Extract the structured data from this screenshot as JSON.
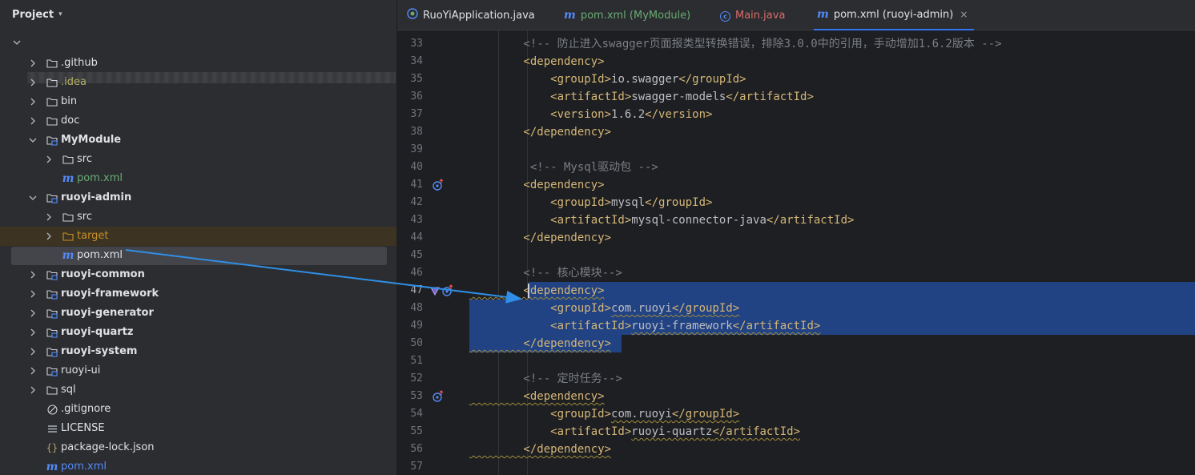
{
  "project_panel": {
    "title": "Project",
    "tree": [
      {
        "label": ".github",
        "type": "folder",
        "style": "normal"
      },
      {
        "label": ".idea",
        "type": "folder",
        "style": "yellow"
      },
      {
        "label": "bin",
        "type": "folder",
        "style": "normal"
      },
      {
        "label": "doc",
        "type": "folder",
        "style": "normal"
      },
      {
        "label": "MyModule",
        "type": "module",
        "style": "bold",
        "expanded": true
      },
      {
        "label": "src",
        "type": "folder",
        "style": "normal"
      },
      {
        "label": "pom.xml",
        "type": "maven",
        "style": "green"
      },
      {
        "label": "ruoyi-admin",
        "type": "module",
        "style": "bold",
        "expanded": true
      },
      {
        "label": "src",
        "type": "folder",
        "style": "normal"
      },
      {
        "label": "target",
        "type": "folder-target",
        "style": "orange"
      },
      {
        "label": "pom.xml",
        "type": "maven",
        "style": "normal",
        "selected": true
      },
      {
        "label": "ruoyi-common",
        "type": "module",
        "style": "bold"
      },
      {
        "label": "ruoyi-framework",
        "type": "module",
        "style": "bold"
      },
      {
        "label": "ruoyi-generator",
        "type": "module",
        "style": "bold"
      },
      {
        "label": "ruoyi-quartz",
        "type": "module",
        "style": "bold"
      },
      {
        "label": "ruoyi-system",
        "type": "module",
        "style": "bold"
      },
      {
        "label": "ruoyi-ui",
        "type": "module",
        "style": "normal"
      },
      {
        "label": "sql",
        "type": "folder",
        "style": "normal"
      },
      {
        "label": ".gitignore",
        "type": "gitignore",
        "style": "normal"
      },
      {
        "label": "LICENSE",
        "type": "license",
        "style": "normal"
      },
      {
        "label": "package-lock.json",
        "type": "json",
        "style": "normal"
      },
      {
        "label": "pom.xml",
        "type": "maven",
        "style": "maven-root"
      }
    ]
  },
  "tabs": [
    {
      "label": "RuoYiApplication.java",
      "icon": "spring-app-icon",
      "color": "#dfe1e5"
    },
    {
      "label": "pom.xml (MyModule)",
      "icon": "maven-icon",
      "color": "#6aab73"
    },
    {
      "label": "Main.java",
      "icon": "class-icon",
      "color": "#d96c6c"
    },
    {
      "label": "pom.xml (ruoyi-admin)",
      "icon": "maven-icon",
      "color": "#dfe1e5",
      "active": true,
      "close": "×"
    }
  ],
  "editor": {
    "lines": [
      {
        "n": "33",
        "tokens": [
          [
            "cm",
            "        <!-- 防止进入swagger页面报类型转换错误，排除3.0.0中的引用，手动增加1.6.2版本 -->"
          ]
        ]
      },
      {
        "n": "34",
        "tokens": [
          [
            "tg",
            "        <dependency>"
          ]
        ]
      },
      {
        "n": "35",
        "tokens": [
          [
            "tg",
            "            <groupId>"
          ],
          [
            "tx",
            "io.swagger"
          ],
          [
            "tg",
            "</groupId>"
          ]
        ]
      },
      {
        "n": "36",
        "tokens": [
          [
            "tg",
            "            <artifactId>"
          ],
          [
            "tx",
            "swagger-models"
          ],
          [
            "tg",
            "</artifactId>"
          ]
        ]
      },
      {
        "n": "37",
        "tokens": [
          [
            "tg",
            "            <version>"
          ],
          [
            "tx",
            "1.6.2"
          ],
          [
            "tg",
            "</version>"
          ]
        ]
      },
      {
        "n": "38",
        "tokens": [
          [
            "tg",
            "        </dependency>"
          ]
        ]
      },
      {
        "n": "39",
        "tokens": []
      },
      {
        "n": "40",
        "tokens": [
          [
            "cm",
            "         <!-- Mysql驱动包 -->"
          ]
        ]
      },
      {
        "n": "41",
        "tokens": [
          [
            "tg",
            "        <dependency>"
          ]
        ]
      },
      {
        "n": "42",
        "tokens": [
          [
            "tg",
            "            <groupId>"
          ],
          [
            "tx",
            "mysql"
          ],
          [
            "tg",
            "</groupId>"
          ]
        ]
      },
      {
        "n": "43",
        "tokens": [
          [
            "tg",
            "            <artifactId>"
          ],
          [
            "tx",
            "mysql-connector-java"
          ],
          [
            "tg",
            "</artifactId>"
          ]
        ]
      },
      {
        "n": "44",
        "tokens": [
          [
            "tg",
            "        </dependency>"
          ]
        ]
      },
      {
        "n": "45",
        "tokens": []
      },
      {
        "n": "46",
        "tokens": [
          [
            "cm",
            "        <!-- 核心模块-->"
          ]
        ]
      },
      {
        "n": "47",
        "tokens": [
          [
            "tg",
            "        <dependency>"
          ]
        ]
      },
      {
        "n": "48",
        "tokens": [
          [
            "tg",
            "            <groupId>"
          ],
          [
            "tx",
            "com.ruoyi"
          ],
          [
            "tg",
            "</groupId>"
          ]
        ]
      },
      {
        "n": "49",
        "tokens": [
          [
            "tg",
            "            <artifactId>"
          ],
          [
            "tx",
            "ruoyi-framework"
          ],
          [
            "tg",
            "</artifactId>"
          ]
        ]
      },
      {
        "n": "50",
        "tokens": [
          [
            "tg",
            "        </dependency>"
          ]
        ]
      },
      {
        "n": "51",
        "tokens": []
      },
      {
        "n": "52",
        "tokens": [
          [
            "cm",
            "        <!-- 定时任务-->"
          ]
        ]
      },
      {
        "n": "53",
        "tokens": [
          [
            "tg",
            "        <dependency>"
          ]
        ]
      },
      {
        "n": "54",
        "tokens": [
          [
            "tg",
            "            <groupId>"
          ],
          [
            "tx",
            "com.ruoyi"
          ],
          [
            "tg",
            "</groupId>"
          ]
        ]
      },
      {
        "n": "55",
        "tokens": [
          [
            "tg",
            "            <artifactId>"
          ],
          [
            "tx",
            "ruoyi-quartz"
          ],
          [
            "tg",
            "</artifactId>"
          ]
        ]
      },
      {
        "n": "56",
        "tokens": [
          [
            "tg",
            "        </dependency>"
          ]
        ]
      },
      {
        "n": "57",
        "tokens": []
      }
    ],
    "selected_lines": [
      "47",
      "48",
      "49",
      "50"
    ],
    "current_line": "47",
    "wavy_lines": [
      "47",
      "48",
      "49",
      "50",
      "53",
      "54",
      "55",
      "56"
    ],
    "gutter_markers": {
      "41": "dependency-goto-icon",
      "47": "dependency-goto-icon",
      "53": "dependency-goto-icon"
    }
  },
  "colors": {
    "accent": "#3574f0",
    "annotation_arrow": "#2f8fe6",
    "selection": "#214283"
  }
}
